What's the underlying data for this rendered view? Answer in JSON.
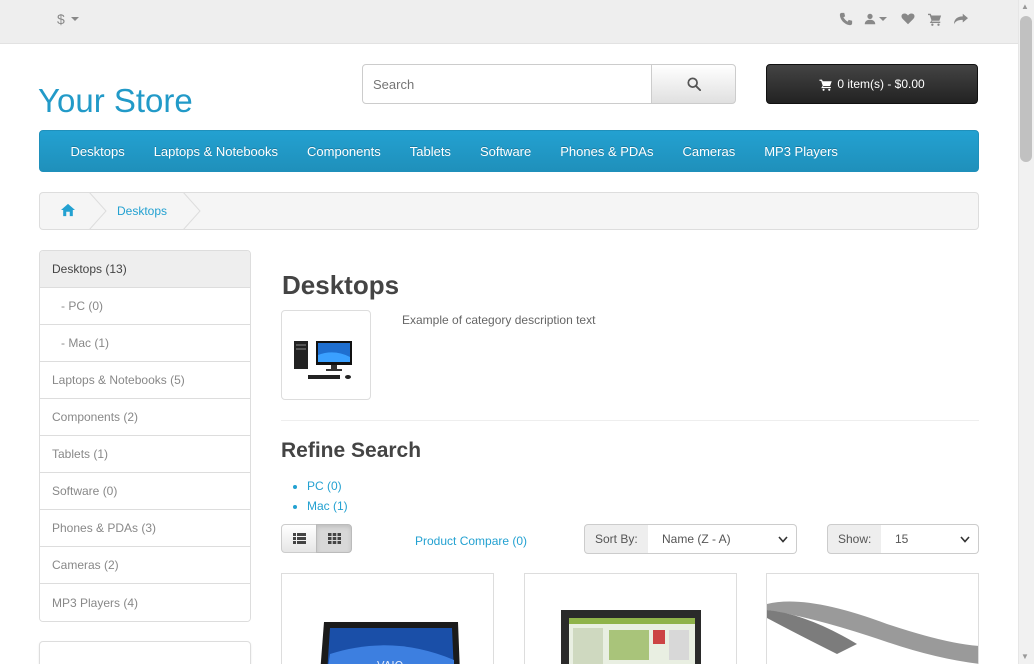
{
  "topbar": {
    "currency": "$",
    "icons": [
      "phone-icon",
      "user-icon",
      "heart-icon",
      "cart-icon",
      "share-icon"
    ]
  },
  "header": {
    "logo": "Your Store",
    "search_placeholder": "Search",
    "cart_label": "0 item(s) - $0.00"
  },
  "menu": {
    "items": [
      "Desktops",
      "Laptops & Notebooks",
      "Components",
      "Tablets",
      "Software",
      "Phones & PDAs",
      "Cameras",
      "MP3 Players"
    ]
  },
  "breadcrumb": {
    "items": [
      "Desktops"
    ]
  },
  "sidebar": {
    "items": [
      {
        "label": "Desktops (13)",
        "active": true
      },
      {
        "label": "- PC (0)",
        "sub": true
      },
      {
        "label": "- Mac (1)",
        "sub": true
      },
      {
        "label": "Laptops & Notebooks (5)"
      },
      {
        "label": "Components (2)"
      },
      {
        "label": "Tablets (1)"
      },
      {
        "label": "Software (0)"
      },
      {
        "label": "Phones & PDAs (3)"
      },
      {
        "label": "Cameras (2)"
      },
      {
        "label": "MP3 Players (4)"
      }
    ]
  },
  "main": {
    "title": "Desktops",
    "description": "Example of category description text",
    "refine_title": "Refine Search",
    "refine_links": [
      "PC (0)",
      "Mac (1)"
    ],
    "compare_label": "Product Compare (0)",
    "sort_label": "Sort By:",
    "sort_value": "Name (Z - A)",
    "show_label": "Show:",
    "show_value": "15"
  },
  "colors": {
    "accent": "#229ac8",
    "menu_bg": "#23a1d1",
    "cart_bg": "#333333"
  }
}
